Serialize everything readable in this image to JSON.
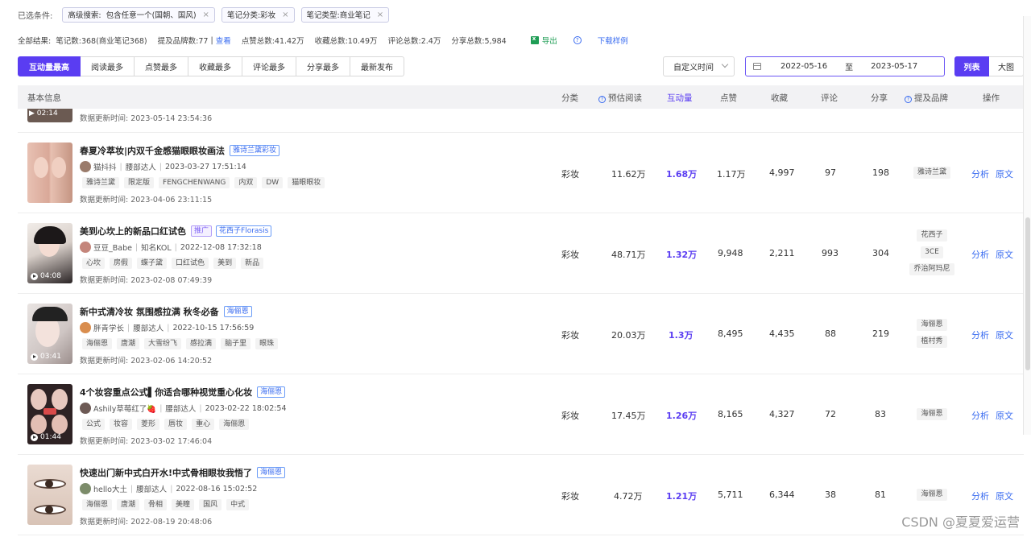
{
  "filters": {
    "label": "已选条件:",
    "chips": [
      {
        "key": "高级搜索:",
        "value": "包含任意一个(国朝、国风)"
      },
      {
        "key": "笔记分类:",
        "value": "彩妆"
      },
      {
        "key": "笔记类型:",
        "value": "商业笔记"
      }
    ],
    "close_glyph": "×"
  },
  "summary": {
    "label": "全部结果:",
    "notes": "笔记数:368(商业笔记368)",
    "brands": "提及品牌数:77",
    "view": "查看",
    "likes": "点赞总数:41.42万",
    "collects": "收藏总数:10.49万",
    "comments": "评论总数:2.4万",
    "shares": "分享总数:5,984",
    "export": "导出",
    "download": "下载样例"
  },
  "sort_tabs": [
    "互动量最高",
    "阅读最多",
    "点赞最多",
    "收藏最多",
    "评论最多",
    "分享最多",
    "最新发布"
  ],
  "time_select": "自定义时间",
  "date_range": {
    "start": "2022-05-16",
    "to": "至",
    "end": "2023-05-17"
  },
  "view_toggle": {
    "list": "列表",
    "grid": "大图"
  },
  "table_header": {
    "basic": "基本信息",
    "category": "分类",
    "reads": "预估阅读",
    "interactions": "互动量",
    "likes": "点赞",
    "collects": "收藏",
    "comments": "评论",
    "shares": "分享",
    "brands": "提及品牌",
    "ops": "操作"
  },
  "partial_row": {
    "duration": "02:14",
    "updated": "数据更新时间:  2023-05-14 23:54:36"
  },
  "rows": [
    {
      "title": "春夏冷萃妆|内双千金感猫眼眼妆画法",
      "tags": [
        "雅诗兰黛彩妆"
      ],
      "author": "猫抖抖",
      "level": "腰部达人",
      "time": "2023-03-27 17:51:14",
      "keywords": [
        "雅诗兰黛",
        "限定版",
        "FENGCHENWANG",
        "内双",
        "DW",
        "猫眼眼妆"
      ],
      "updated": "数据更新时间:  2023-04-06 23:11:15",
      "category": "彩妆",
      "reads": "11.62万",
      "interactions": "1.68万",
      "likes": "1.17万",
      "collects": "4,997",
      "comments": "97",
      "shares": "198",
      "brands": [
        "雅诗兰黛"
      ],
      "duration": ""
    },
    {
      "title": "美到心坎上的新品口红试色",
      "tags": [
        "推广",
        "花西子Florasis"
      ],
      "author": "豆豆_Babe",
      "level": "知名KOL",
      "time": "2022-12-08 17:32:18",
      "keywords": [
        "心坎",
        "房假",
        "蝶子黛",
        "口红试色",
        "美到",
        "新品"
      ],
      "updated": "数据更新时间:  2023-02-08 07:49:39",
      "category": "彩妆",
      "reads": "48.71万",
      "interactions": "1.32万",
      "likes": "9,948",
      "collects": "2,211",
      "comments": "993",
      "shares": "304",
      "brands": [
        "花西子",
        "3CE",
        "乔治阿玛尼"
      ],
      "duration": "04:08"
    },
    {
      "title": "新中式清冷妆 氛围感拉满 秋冬必备",
      "tags": [
        "海俪恩"
      ],
      "author": "胖青学长",
      "level": "腰部达人",
      "time": "2022-10-15 17:56:59",
      "keywords": [
        "海俪恩",
        "唐潮",
        "大雪纷飞",
        "感拉满",
        "脑子里",
        "眼珠"
      ],
      "updated": "数据更新时间:  2023-02-06 14:20:52",
      "category": "彩妆",
      "reads": "20.03万",
      "interactions": "1.3万",
      "likes": "8,495",
      "collects": "4,435",
      "comments": "88",
      "shares": "219",
      "brands": [
        "海俪恩",
        "植村秀"
      ],
      "duration": "03:41"
    },
    {
      "title": "4个妆容重点公式▌你适合哪种视觉重心化妆",
      "tags": [
        "海俪恩"
      ],
      "author": "Ashily草莓红了🍓",
      "level": "腰部达人",
      "time": "2023-02-22 18:02:54",
      "keywords": [
        "公式",
        "妆容",
        "菱形",
        "唇妆",
        "重心",
        "海俪恩"
      ],
      "updated": "数据更新时间:  2023-03-02 17:46:04",
      "category": "彩妆",
      "reads": "17.45万",
      "interactions": "1.26万",
      "likes": "8,165",
      "collects": "4,327",
      "comments": "72",
      "shares": "83",
      "brands": [
        "海俪恩"
      ],
      "duration": "01:44"
    },
    {
      "title": "快速出门新中式白开水!中式骨相眼妆我悟了",
      "tags": [
        "海俪恩"
      ],
      "author": "hello大土",
      "level": "腰部达人",
      "time": "2022-08-16 15:02:52",
      "keywords": [
        "海俪恩",
        "唐潮",
        "骨相",
        "美瞳",
        "国风",
        "中式"
      ],
      "updated": "数据更新时间:  2022-08-19 20:48:06",
      "category": "彩妆",
      "reads": "4.72万",
      "interactions": "1.21万",
      "likes": "5,711",
      "collects": "6,344",
      "comments": "38",
      "shares": "81",
      "brands": [
        "海俪恩"
      ],
      "duration": ""
    }
  ],
  "ops": {
    "analyze": "分析",
    "original": "原文"
  },
  "watermark": "CSDN @夏夏爱运营",
  "colors": {
    "accent": "#5a3df2",
    "link": "#3a6cf0",
    "excel": "#1f9d55"
  }
}
